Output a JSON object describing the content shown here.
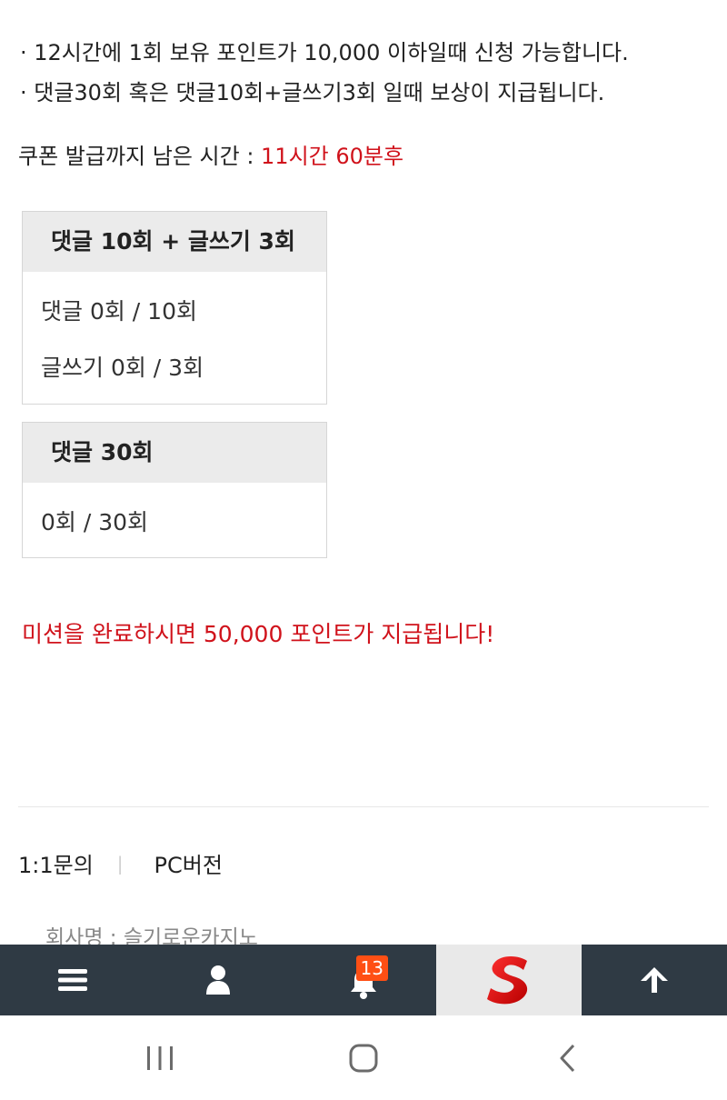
{
  "notices": [
    "· 12시간에 1회 보유 포인트가 10,000 이하일때 신청 가능합니다.",
    "· 댓글30회 혹은 댓글10회+글쓰기3회 일때 보상이 지급됩니다."
  ],
  "timer": {
    "label": "쿠폰 발급까지 남은 시간 : ",
    "value": "11시간 60분후"
  },
  "mission_a": {
    "title": "댓글 10회 + 글쓰기 3회",
    "comments": "댓글 0회 / 10회",
    "posts": "글쓰기 0회 / 3회"
  },
  "mission_b": {
    "title": "댓글 30회",
    "comments": "0회 / 30회"
  },
  "complete_message": "미션을 완료하시면 50,000 포인트가 지급됩니다!",
  "footer": {
    "inquiry": "1:1문의",
    "separator": "|",
    "pc_version": "PC버전",
    "company": "회사명 : 슬기로운카지노"
  },
  "bottom_nav": {
    "notification_count": "13",
    "icons": [
      "menu-icon",
      "user-icon",
      "bell-icon",
      "site-logo",
      "arrow-up-icon"
    ]
  },
  "colors": {
    "accent_red": "#d0121b",
    "nav_bg": "#2f3a44",
    "badge": "#ff4f14"
  }
}
